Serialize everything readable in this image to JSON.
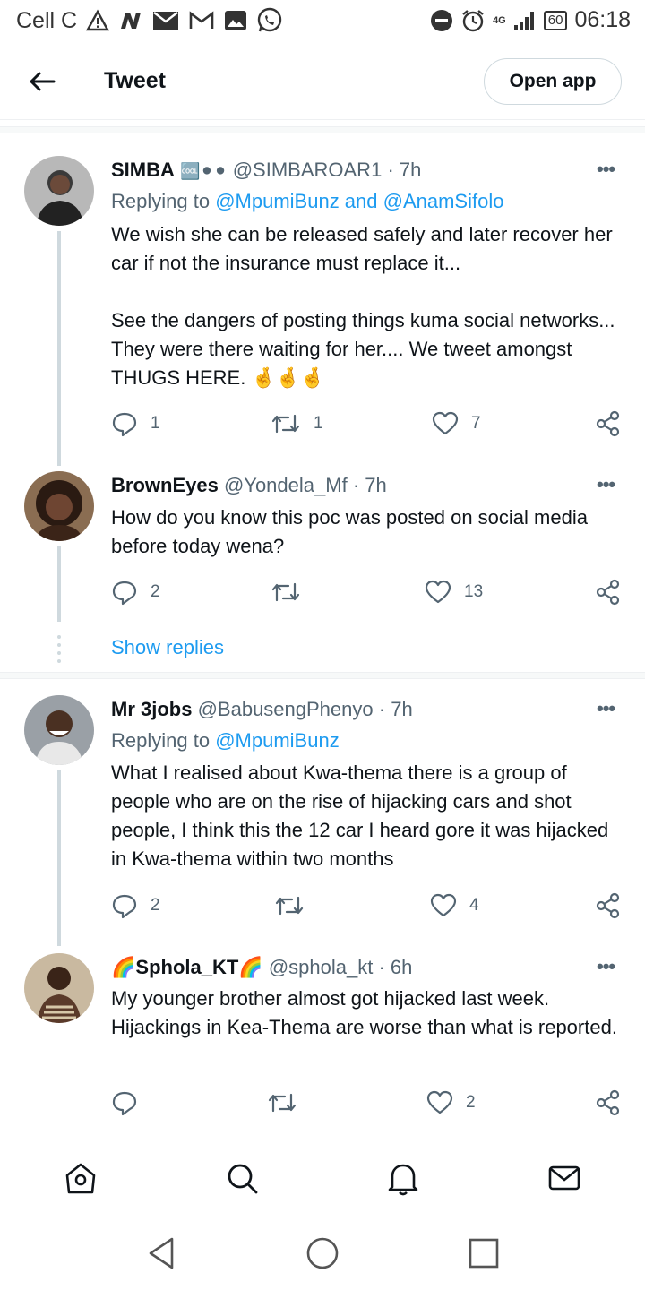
{
  "status_bar": {
    "carrier": "Cell C",
    "network": "4G",
    "battery": "60",
    "time": "06:18"
  },
  "header": {
    "title": "Tweet",
    "open_app_label": "Open app"
  },
  "tweets": [
    {
      "name": "SIMBA",
      "name_badges": "🆒⚫⚫",
      "handle": "@SIMBAROAR1",
      "time": "· 7h",
      "replying_prefix": "Replying to",
      "replying_users": "@MpumiBunz and @AnamSifolo",
      "text": "We wish she can be released safely and later recover her car if not the insurance must replace it...\n\nSee the dangers of posting things kuma social networks... They were there waiting for her.... We tweet amongst THUGS HERE. 🤞🤞🤞",
      "replies": "1",
      "retweets": "1",
      "likes": "7"
    },
    {
      "name": "BrownEyes",
      "handle": "@Yondela_Mf",
      "time": "· 7h",
      "text": "How do you know this poc was posted on social media before today wena?",
      "replies": "2",
      "retweets": "",
      "likes": "13",
      "show_replies": "Show replies"
    },
    {
      "name": "Mr 3jobs",
      "handle": "@BabusengPhenyo",
      "time": "· 7h",
      "replying_prefix": "Replying to",
      "replying_users": "@MpumiBunz",
      "text": "What I realised about Kwa-thema there is a group of people who are on the rise of hijacking cars and shot people, I think this the 12 car I heard gore it was hijacked in Kwa-thema within two months",
      "replies": "2",
      "retweets": "",
      "likes": "4"
    },
    {
      "name": "🌈Sphola_KT🌈",
      "handle": "@sphola_kt",
      "time": "· 6h",
      "text": "My younger brother almost got hijacked last week. Hijackings in Kea-Thema are worse than what is reported.",
      "replies": "",
      "retweets": "",
      "likes": "2"
    }
  ],
  "icons": {
    "reply": "reply-icon",
    "retweet": "retweet-icon",
    "like": "heart-icon",
    "share": "share-icon",
    "more": "more-icon"
  },
  "colors": {
    "link": "#1d9bf0",
    "text": "#0f1419",
    "secondary": "#536471"
  }
}
